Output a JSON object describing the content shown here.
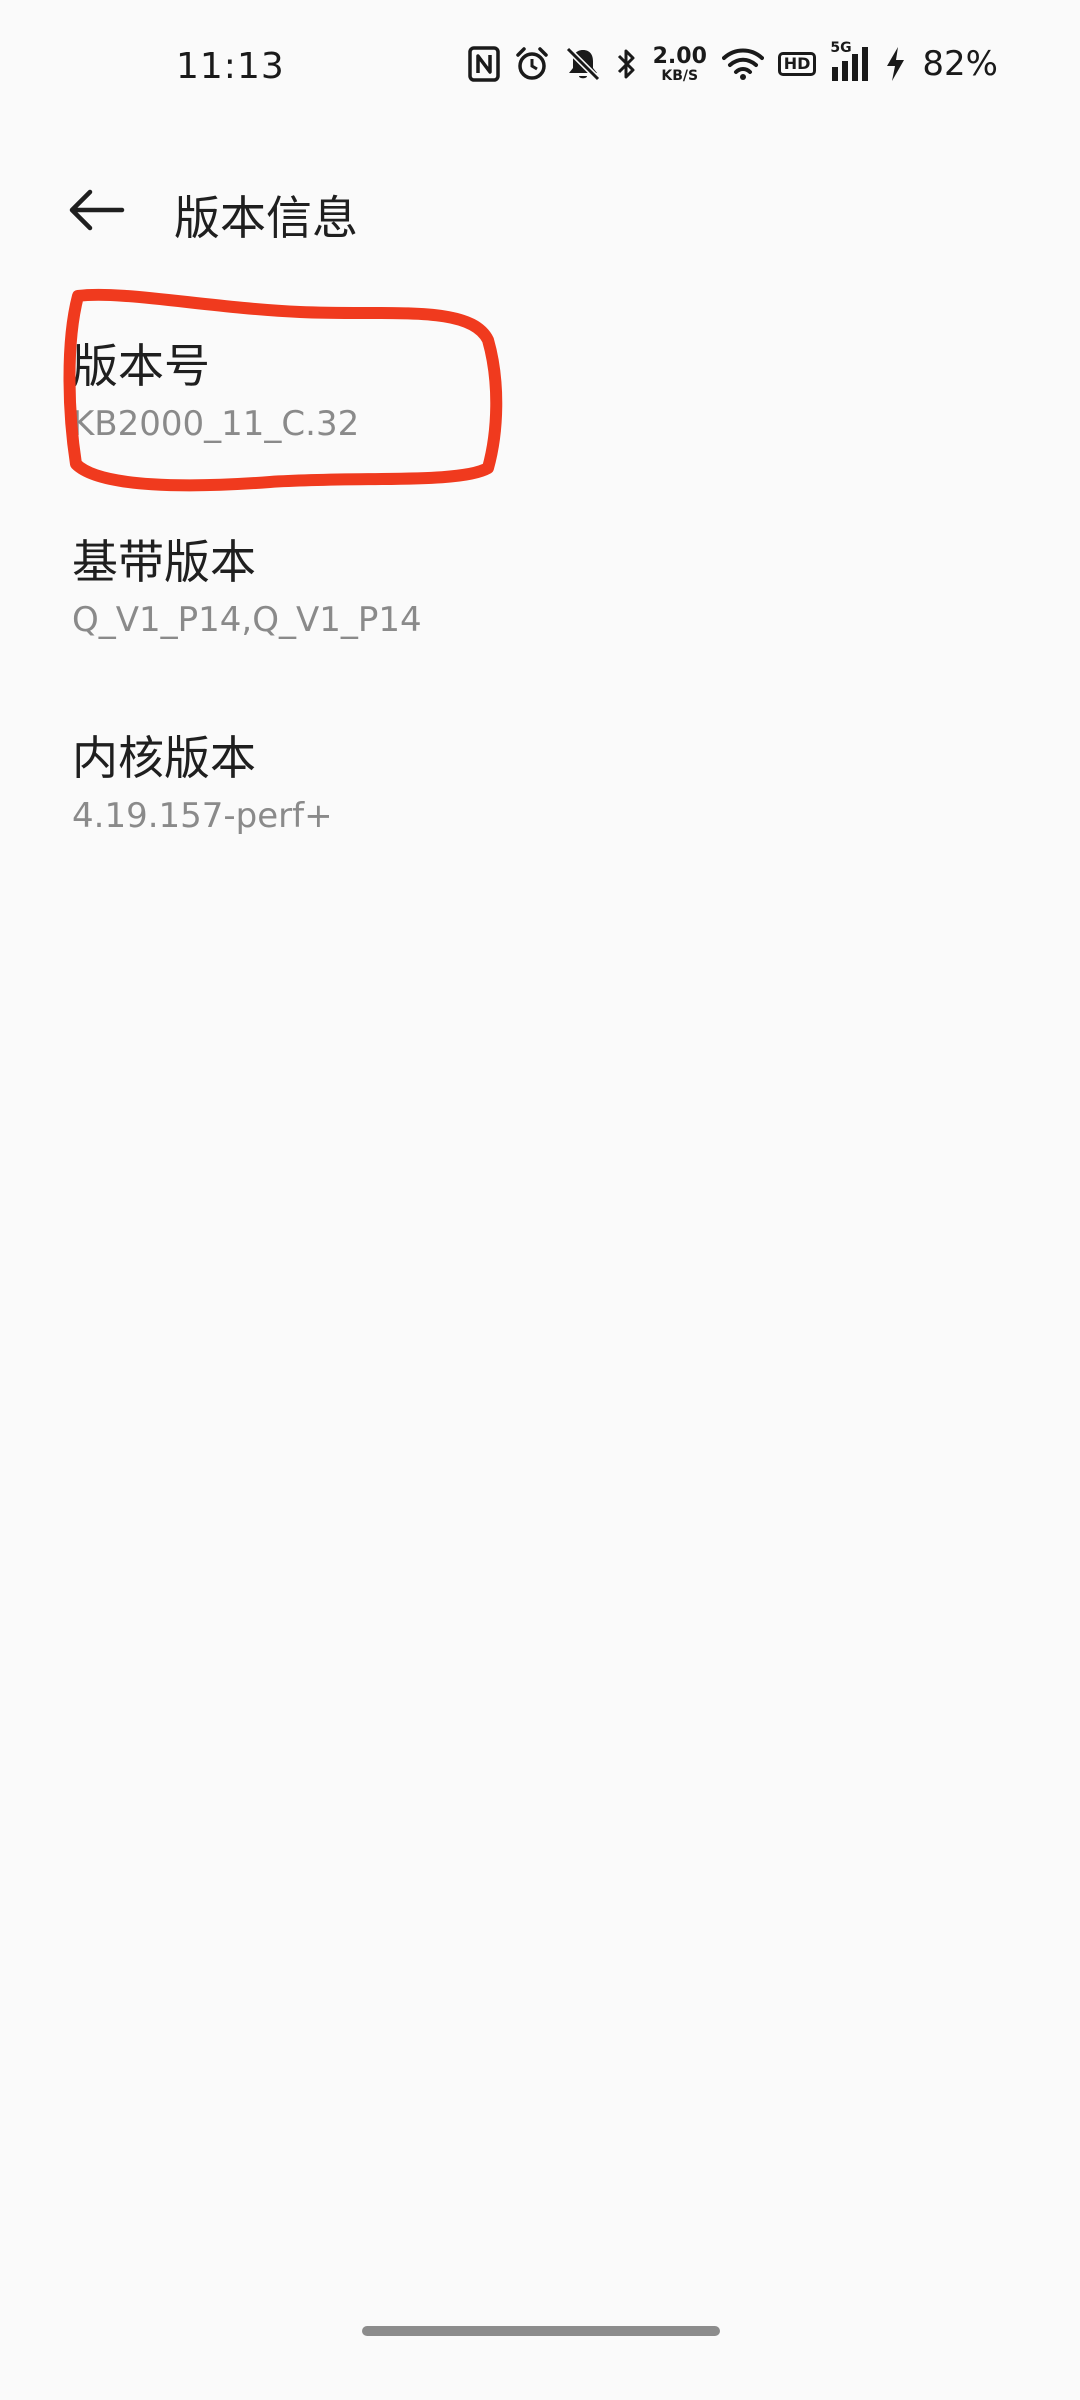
{
  "status_bar": {
    "time": "11:13",
    "net_speed_value": "2.00",
    "net_speed_unit": "KB/S",
    "hd_label": "HD",
    "network_type": "5G",
    "battery_percent": "82%",
    "icons": [
      "nfc-icon",
      "alarm-icon",
      "mute-icon",
      "bluetooth-icon",
      "wifi-icon",
      "hd-icon",
      "signal-icon",
      "charging-icon"
    ]
  },
  "header": {
    "title": "版本信息",
    "back_icon": "arrow-left-icon"
  },
  "items": [
    {
      "title": "版本号",
      "value": "KB2000_11_C.32"
    },
    {
      "title": "基带版本",
      "value": "Q_V1_P14,Q_V1_P14"
    },
    {
      "title": "内核版本",
      "value": "4.19.157-perf+"
    }
  ],
  "colors": {
    "background": "#fafafa",
    "annotation": "#f03a1e",
    "primary_text": "#1f1f1f",
    "secondary_text": "#8a8a8a"
  }
}
